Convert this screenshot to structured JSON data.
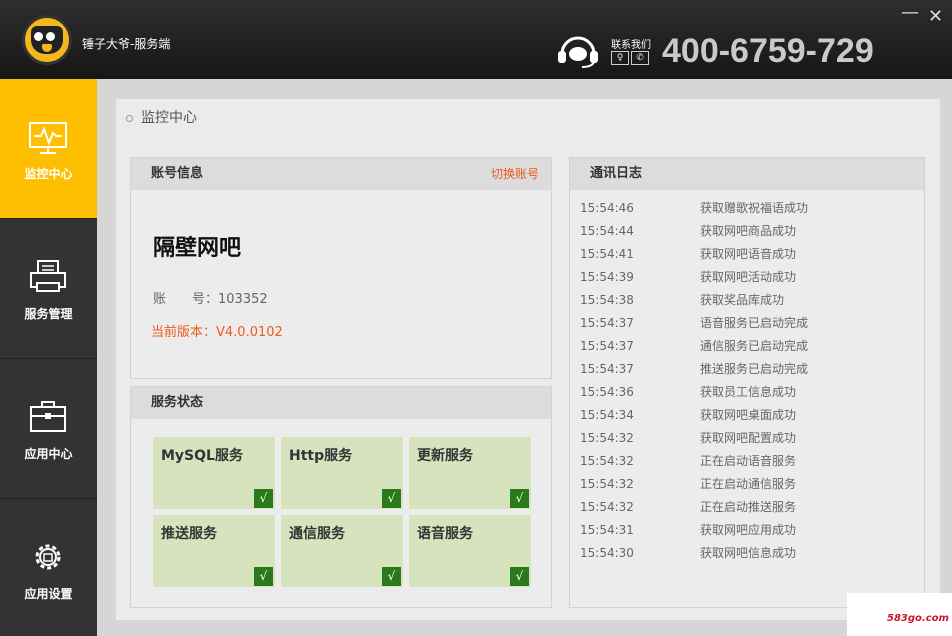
{
  "app": {
    "title": "锤子大爷-服务端"
  },
  "header": {
    "contact_label": "联系我们",
    "hotline": "400-6759-729"
  },
  "window_controls": {
    "minimize": "—",
    "close": "✕"
  },
  "sidebar": {
    "items": [
      {
        "label": "监控中心",
        "icon": "monitor-icon",
        "active": true
      },
      {
        "label": "服务管理",
        "icon": "printer-icon",
        "active": false
      },
      {
        "label": "应用中心",
        "icon": "briefcase-icon",
        "active": false
      },
      {
        "label": "应用设置",
        "icon": "gear-icon",
        "active": false
      }
    ]
  },
  "main": {
    "breadcrumb": "监控中心",
    "account": {
      "heading": "账号信息",
      "switch_label": "切换账号",
      "shop_name": "隔壁网吧",
      "account_line": "账　　号：103352",
      "version_line": "当前版本：V4.0.0102"
    },
    "services": {
      "heading": "服务状态",
      "items": [
        {
          "name": "MySQL服务",
          "status": "√"
        },
        {
          "name": "Http服务",
          "status": "√"
        },
        {
          "name": "更新服务",
          "status": "√"
        },
        {
          "name": "推送服务",
          "status": "√"
        },
        {
          "name": "通信服务",
          "status": "√"
        },
        {
          "name": "语音服务",
          "status": "√"
        }
      ]
    },
    "log": {
      "heading": "通讯日志",
      "entries": [
        {
          "time": "15:54:46",
          "msg": "获取赠歌祝福语成功"
        },
        {
          "time": "15:54:44",
          "msg": "获取网吧商品成功"
        },
        {
          "time": "15:54:41",
          "msg": "获取网吧语音成功"
        },
        {
          "time": "15:54:39",
          "msg": "获取网吧活动成功"
        },
        {
          "time": "15:54:38",
          "msg": "获取奖品库成功"
        },
        {
          "time": "15:54:37",
          "msg": "语音服务已启动完成"
        },
        {
          "time": "15:54:37",
          "msg": "通信服务已启动完成"
        },
        {
          "time": "15:54:37",
          "msg": "推送服务已启动完成"
        },
        {
          "time": "15:54:36",
          "msg": "获取员工信息成功"
        },
        {
          "time": "15:54:34",
          "msg": "获取网吧桌面成功"
        },
        {
          "time": "15:54:32",
          "msg": "获取网吧配置成功"
        },
        {
          "time": "15:54:32",
          "msg": "正在启动语音服务"
        },
        {
          "time": "15:54:32",
          "msg": "正在启动通信服务"
        },
        {
          "time": "15:54:32",
          "msg": "正在启动推送服务"
        },
        {
          "time": "15:54:31",
          "msg": "获取网吧应用成功"
        },
        {
          "time": "15:54:30",
          "msg": "获取网吧信息成功"
        }
      ]
    }
  },
  "watermark": "583go.com",
  "colors": {
    "accent": "#fdbf00",
    "sidebar": "#333333",
    "link": "#ee5a1a",
    "service_ok": "#2a7a1a"
  }
}
